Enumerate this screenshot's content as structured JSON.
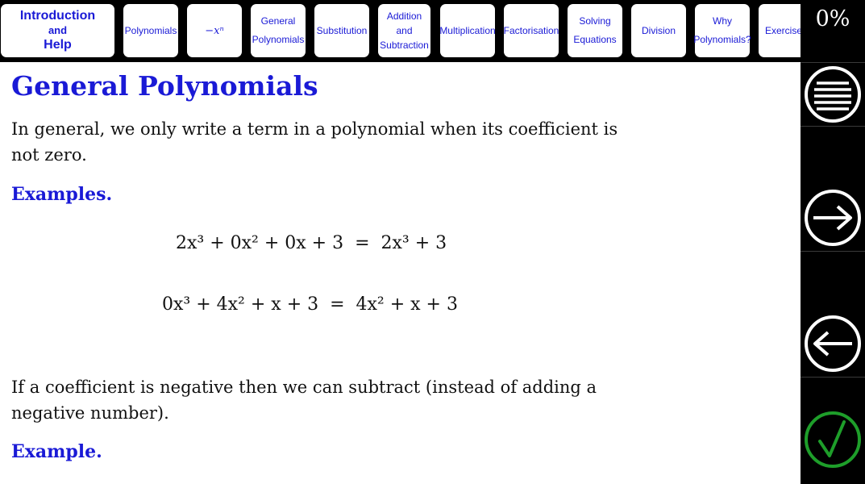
{
  "nav": {
    "tabs": [
      {
        "label_lines": [
          "Introduction",
          "and",
          "Help"
        ]
      },
      {
        "label_lines": [
          "Polynomials"
        ]
      },
      {
        "label_lines": [
          "−xⁿ"
        ]
      },
      {
        "label_lines": [
          "General",
          "Polynomials"
        ]
      },
      {
        "label_lines": [
          "Substitution"
        ]
      },
      {
        "label_lines": [
          "Addition",
          "and",
          "Subtraction"
        ]
      },
      {
        "label_lines": [
          "Multiplication"
        ]
      },
      {
        "label_lines": [
          "Factorisation"
        ]
      },
      {
        "label_lines": [
          "Solving",
          "Equations"
        ]
      },
      {
        "label_lines": [
          "Division"
        ]
      },
      {
        "label_lines": [
          "Why",
          "Polynomials?"
        ]
      },
      {
        "label_lines": [
          "Exercises"
        ]
      }
    ]
  },
  "side": {
    "progress": "0%",
    "buttons": [
      {
        "icon": "menu-icon"
      },
      {
        "icon": "arrow-right-icon"
      },
      {
        "icon": "arrow-left-icon"
      },
      {
        "icon": "checkmark-icon"
      }
    ],
    "colors": {
      "menu": "#ffffff",
      "check": "#1e9e2a"
    }
  },
  "content": {
    "title": "General Polynomials",
    "intro": "In general, we only write a term in a polynomial when its coefficient is not zero.",
    "examples_heading": "Examples.",
    "equations": [
      "2x³ + 0x² + 0x + 3  =  2x³ + 3",
      "0x³ + 4x² + x + 3  =  4x² + x + 3"
    ],
    "negative_note": "If a coefficient is negative then we can subtract (instead of adding a negative number).",
    "example_heading": "Example."
  },
  "colors": {
    "accent": "#1a1ad6",
    "background": "#ffffff",
    "frame": "#000000"
  }
}
